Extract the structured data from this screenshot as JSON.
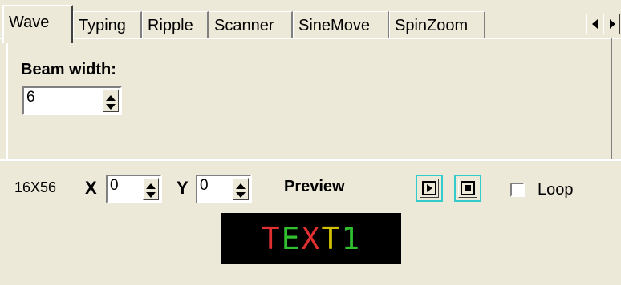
{
  "tabs": [
    {
      "label": "Wave",
      "active": true
    },
    {
      "label": "Typing"
    },
    {
      "label": "Ripple"
    },
    {
      "label": "Scanner"
    },
    {
      "label": "SineMove"
    },
    {
      "label": "SpinZoom"
    }
  ],
  "wave_tab": {
    "beam_width_label": "Beam width:",
    "beam_width_value": "6"
  },
  "bottom": {
    "dimensions": "16X56",
    "x_label": "X",
    "x_value": "0",
    "y_label": "Y",
    "y_value": "0",
    "preview_label": "Preview",
    "loop_label": "Loop",
    "loop_checked": false
  },
  "preview_text": {
    "chars": [
      {
        "c": "T",
        "color": "#e03030"
      },
      {
        "c": "E",
        "color": "#30c030"
      },
      {
        "c": "X",
        "color": "#e03030"
      },
      {
        "c": "T",
        "color": "#d0c000"
      },
      {
        "c": "1",
        "color": "#30c030"
      }
    ]
  },
  "colors": {
    "background": "#ece9d8",
    "button_highlight": "#33cccc",
    "led_background": "#000000"
  }
}
